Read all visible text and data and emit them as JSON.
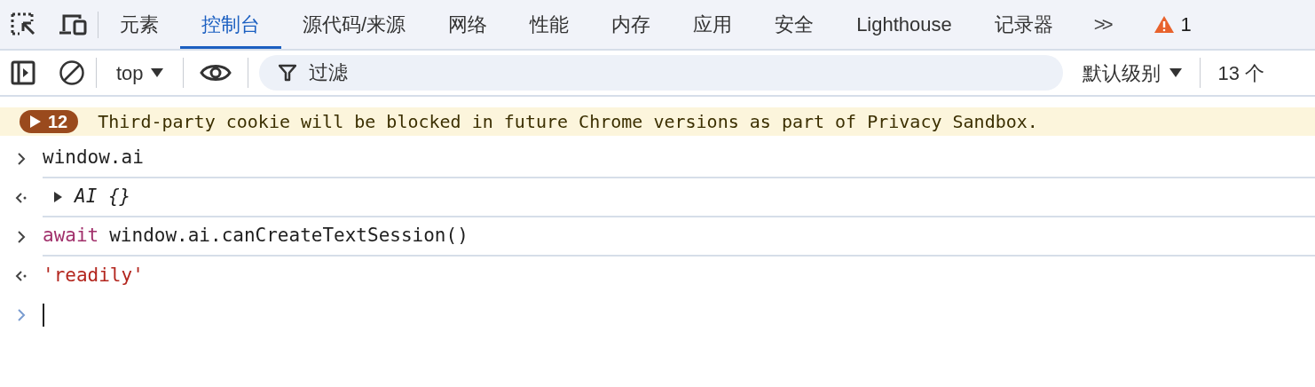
{
  "tabs": [
    {
      "label": "元素",
      "selected": false
    },
    {
      "label": "控制台",
      "selected": true
    },
    {
      "label": "源代码/来源",
      "selected": false
    },
    {
      "label": "网络",
      "selected": false
    },
    {
      "label": "性能",
      "selected": false
    },
    {
      "label": "内存",
      "selected": false
    },
    {
      "label": "应用",
      "selected": false
    },
    {
      "label": "安全",
      "selected": false
    },
    {
      "label": "Lighthouse",
      "selected": false
    },
    {
      "label": "记录器",
      "selected": false
    }
  ],
  "more_tabs": ">>",
  "warning_count": "1",
  "toolbar": {
    "context": "top",
    "filter_placeholder": "过滤",
    "level": "默认级别",
    "issues": "13 个"
  },
  "issue_banner": {
    "count": "12",
    "message": "Third-party cookie will be blocked in future Chrome versions as part of Privacy Sandbox."
  },
  "entries": [
    {
      "kind": "input",
      "parts": [
        {
          "kind": "plain",
          "text": "window.ai"
        }
      ]
    },
    {
      "kind": "output",
      "expanded": false,
      "parts": [
        {
          "kind": "object",
          "text": "AI {}"
        }
      ]
    },
    {
      "kind": "input",
      "parts": [
        {
          "kind": "keyword",
          "text": "await"
        },
        {
          "kind": "plain",
          "text": "window.ai.canCreateTextSession()"
        }
      ]
    },
    {
      "kind": "output",
      "parts": [
        {
          "kind": "string",
          "text": "'readily'"
        }
      ]
    }
  ]
}
